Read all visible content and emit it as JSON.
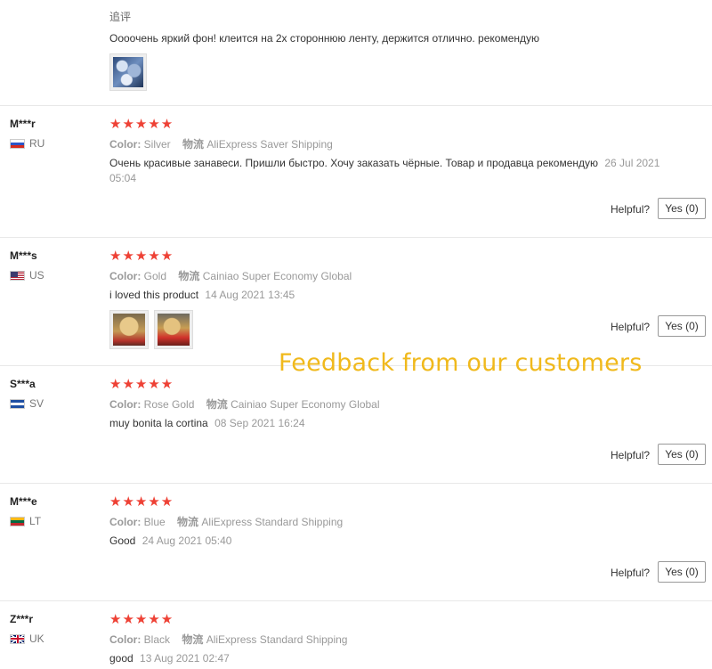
{
  "top_block": {
    "label": "追评",
    "text": "Oooочень яркий фон! клеится на 2х стороннюю ленту, держится отлично. рекомендую",
    "images": [
      "thumb"
    ]
  },
  "overlay": {
    "caption": "Feedback from our customers"
  },
  "helpful_label": "Helpful?",
  "yes_label": "Yes (0)",
  "reviews": [
    {
      "name": "M***r",
      "country": "RU",
      "flag": "ru-flag-icon",
      "stars": "★★★★★",
      "attr_key": "Color:",
      "attr_val": "Silver",
      "ship_key": "物流",
      "ship_val": "AliExpress Saver Shipping",
      "text": "Очень красивые занавеси. Пришли быстро. Хочу заказать чёрные. Товар и продавца рекомендую",
      "date": "26 Jul 2021 05:04"
    },
    {
      "name": "M***s",
      "country": "US",
      "flag": "us-flag-icon",
      "stars": "★★★★★",
      "attr_key": "Color:",
      "attr_val": "Gold",
      "ship_key": "物流",
      "ship_val": "Cainiao Super Economy Global",
      "text": "i loved this product",
      "date": "14 Aug 2021 13:45"
    },
    {
      "name": "S***a",
      "country": "SV",
      "flag": "sv-flag-icon",
      "stars": "★★★★★",
      "attr_key": "Color:",
      "attr_val": "Rose Gold",
      "ship_key": "物流",
      "ship_val": "Cainiao Super Economy Global",
      "text": "muy bonita la cortina",
      "date": "08 Sep 2021 16:24"
    },
    {
      "name": "M***e",
      "country": "LT",
      "flag": "lt-flag-icon",
      "stars": "★★★★★",
      "attr_key": "Color:",
      "attr_val": "Blue",
      "ship_key": "物流",
      "ship_val": "AliExpress Standard Shipping",
      "text": "Good",
      "date": "24 Aug 2021 05:40"
    },
    {
      "name": "Z***r",
      "country": "UK",
      "flag": "uk-flag-icon",
      "stars": "★★★★★",
      "attr_key": "Color:",
      "attr_val": "Black",
      "ship_key": "物流",
      "ship_val": "AliExpress Standard Shipping",
      "text": "good",
      "date": "13 Aug 2021 02:47"
    }
  ]
}
